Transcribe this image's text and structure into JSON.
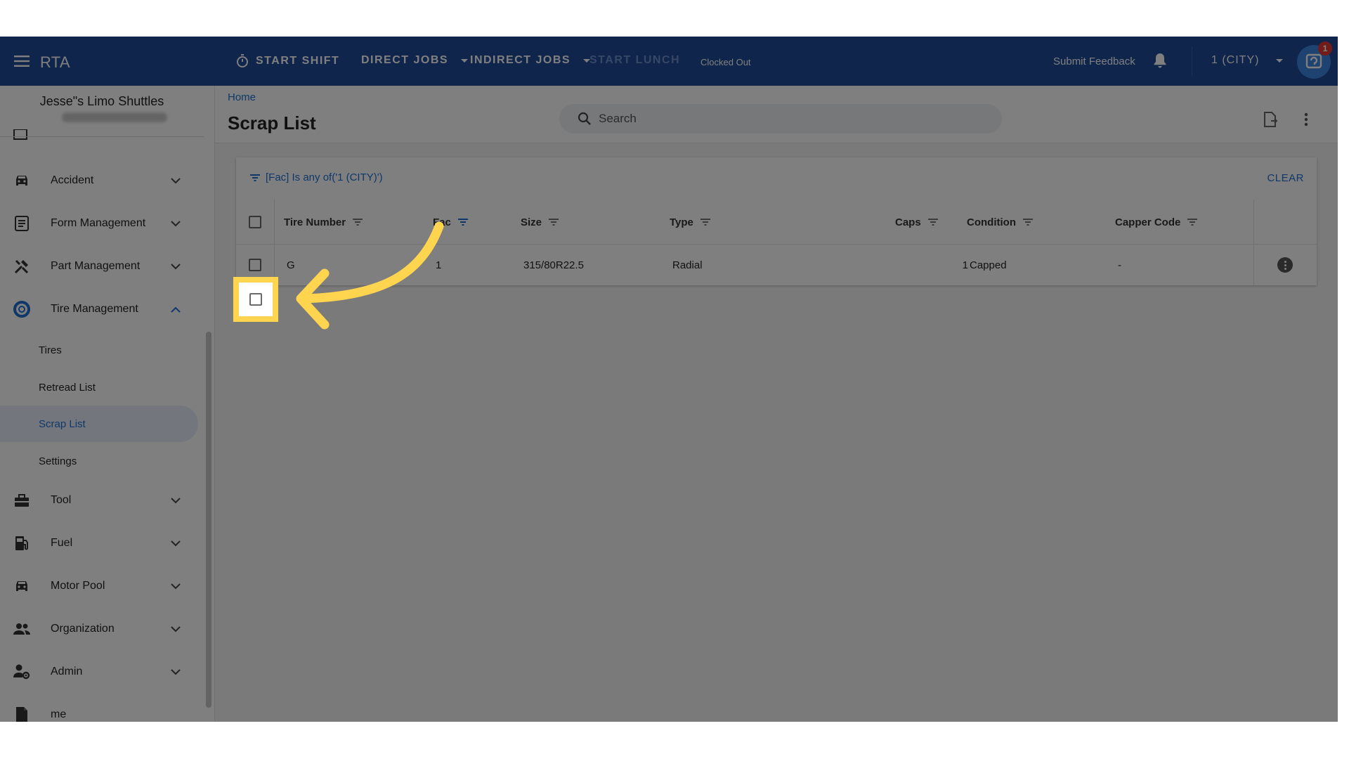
{
  "topbar": {
    "app_title": "RTA",
    "start_shift": "START SHIFT",
    "direct_jobs": "DIRECT JOBS",
    "indirect_jobs": "INDIRECT JOBS",
    "start_lunch": "START LUNCH",
    "clock_status": "Clocked Out",
    "submit_feedback": "Submit Feedback",
    "location": "1 (CITY)",
    "help_badge_count": "1"
  },
  "sidebar": {
    "org_name": "Jesse\"s Limo Shuttles",
    "items": [
      {
        "label": "Accident",
        "icon": "car-icon"
      },
      {
        "label": "Form Management",
        "icon": "form-icon"
      },
      {
        "label": "Part Management",
        "icon": "tools-icon"
      },
      {
        "label": "Tire Management",
        "icon": "tire-icon"
      },
      {
        "label": "Tool",
        "icon": "toolbox-icon"
      },
      {
        "label": "Fuel",
        "icon": "fuel-icon"
      },
      {
        "label": "Motor Pool",
        "icon": "car-icon"
      },
      {
        "label": "Organization",
        "icon": "people-icon"
      },
      {
        "label": "Admin",
        "icon": "admin-icon"
      },
      {
        "label": "me",
        "icon": "file-icon"
      }
    ],
    "tire_sub": [
      {
        "label": "Tires"
      },
      {
        "label": "Retread List"
      },
      {
        "label": "Scrap List",
        "active": true
      },
      {
        "label": "Settings"
      }
    ]
  },
  "page": {
    "breadcrumb": "Home",
    "title": "Scrap List",
    "search_placeholder": "Search"
  },
  "grid": {
    "filter_text": "[Fac] Is any of('1 (CITY)')",
    "clear_label": "CLEAR",
    "columns": [
      "Tire Number",
      "Fac",
      "Size",
      "Type",
      "Caps",
      "Condition",
      "Capper Code"
    ],
    "rows": [
      {
        "tire_number": "G",
        "fac": "1",
        "size": "315/80R22.5",
        "type": "Radial",
        "caps": "1",
        "condition": "Capped",
        "capper_code": "-"
      }
    ]
  },
  "colors": {
    "topbar": "#1f4a99",
    "accent": "#1f6fd1",
    "highlight": "#ffd54f",
    "arrow": "#ffd54f"
  }
}
